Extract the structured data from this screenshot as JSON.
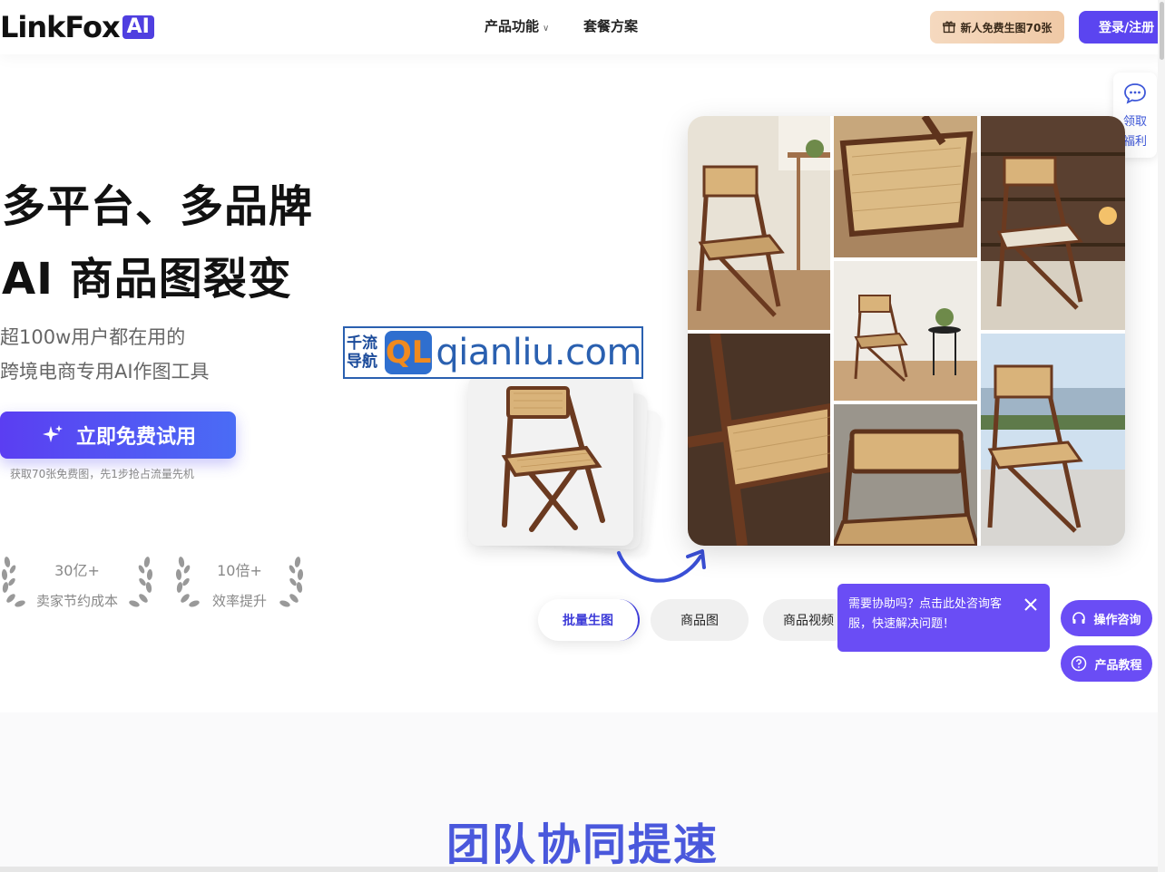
{
  "brand": {
    "name": "LinkFox",
    "badge": "AI"
  },
  "nav": {
    "items": [
      "产品功能",
      "套餐方案"
    ],
    "gift_label": "新人免费生图70张",
    "login_label": "登录/注册"
  },
  "hero": {
    "title_line1": "多平台、多品牌",
    "title_line2": "AI 商品图裂变",
    "sub_line1": "超100w用户都在用的",
    "sub_line2": "跨境电商专用AI作图工具",
    "cta_label": "立即免费试用",
    "cta_note": "获取70张免费图，先1步抢占流量先机",
    "stats": [
      {
        "num": "30亿+",
        "label": "卖家节约成本"
      },
      {
        "num": "10倍+",
        "label": "效率提升"
      }
    ]
  },
  "watermark": {
    "left": "千流导航",
    "mark": "QL",
    "site": "qianliu.com"
  },
  "tabs": [
    "批量生图",
    "商品图",
    "商品视频"
  ],
  "help": {
    "popup_text": "需要协助吗？点击此处咨询客服，快速解决问题！",
    "consult_label": "操作咨询",
    "tutorial_label": "产品教程",
    "side_panel_label": "领取福利"
  },
  "section2": {
    "title": "团队协同提速"
  },
  "colors": {
    "accent": "#5b45f0",
    "popup": "#6a4df5",
    "title_blue": "#4a58dc"
  }
}
